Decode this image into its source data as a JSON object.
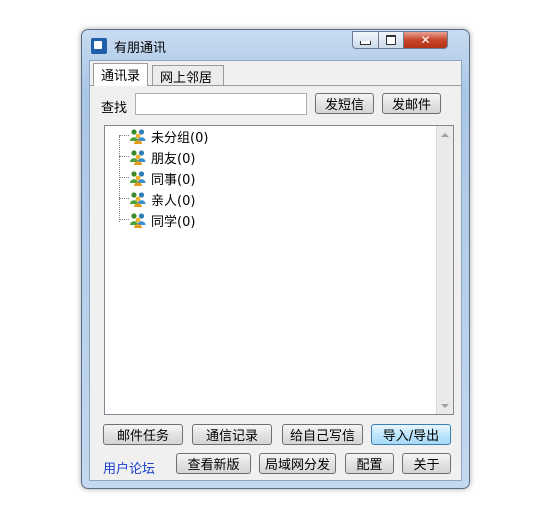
{
  "window": {
    "title": "有朋通讯"
  },
  "tabs": [
    {
      "label": "通讯录",
      "active": true
    },
    {
      "label": "网上邻居",
      "active": false
    }
  ],
  "search": {
    "label": "查找",
    "value": "",
    "sms_button": "发短信",
    "email_button": "发邮件"
  },
  "tree": {
    "groups": [
      {
        "label": "未分组(0)",
        "icon": "user-group-icon"
      },
      {
        "label": "朋友(0)",
        "icon": "user-group-icon"
      },
      {
        "label": "同事(0)",
        "icon": "user-group-icon"
      },
      {
        "label": "亲人(0)",
        "icon": "user-group-icon"
      },
      {
        "label": "同学(0)",
        "icon": "user-group-icon"
      }
    ]
  },
  "actions_row1": {
    "mail_tasks": "邮件任务",
    "comm_log": "通信记录",
    "write_self": "给自己写信",
    "import_export": "导入/导出"
  },
  "actions_row2": {
    "forum_link": "用户论坛",
    "check_version": "查看新版",
    "lan_send": "局域网分发",
    "config": "配置",
    "about": "关于"
  },
  "colors": {
    "frame": "#b9d1ec",
    "link": "#1a3fd0",
    "close_button": "#c7452a"
  }
}
